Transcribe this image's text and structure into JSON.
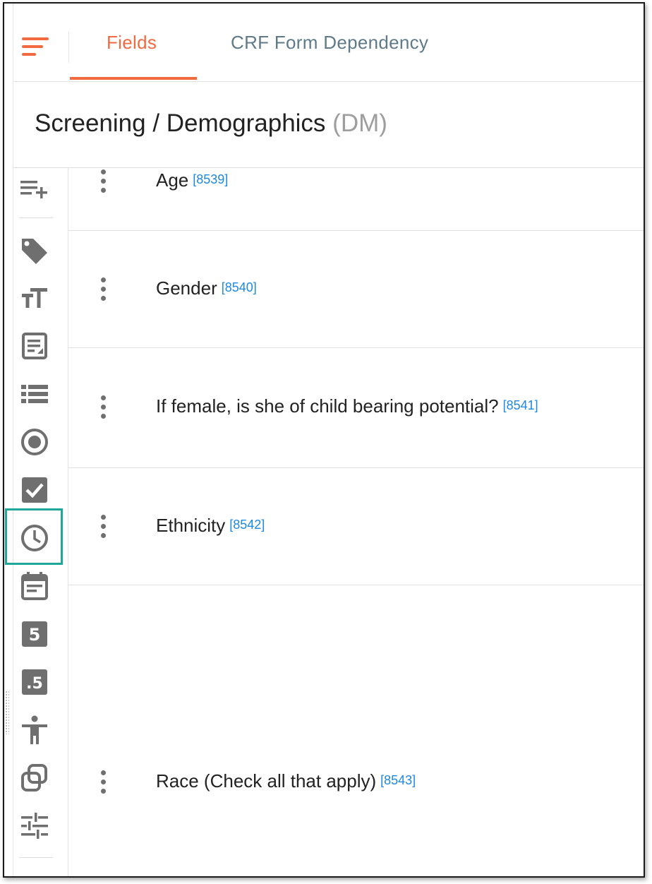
{
  "tabs": [
    {
      "label": "Fields",
      "active": true
    },
    {
      "label": "CRF Form Dependency",
      "active": false
    }
  ],
  "header": {
    "title": "Screening / Demographics",
    "abbr": "(DM)"
  },
  "toolbar": {
    "icons": [
      "add-field-icon",
      "tag-icon",
      "text-size-icon",
      "text-area-icon",
      "list-icon",
      "radio-icon",
      "checkbox-icon",
      "time-icon",
      "date-icon",
      "integer-icon",
      "decimal-icon",
      "person-icon",
      "copy-icon",
      "settings-sliders-icon"
    ],
    "selected": "time-icon"
  },
  "fields": [
    {
      "label": "Age",
      "id": "[8539]"
    },
    {
      "label": "Gender",
      "id": "[8540]"
    },
    {
      "label": "If female, is she of child bearing potential?",
      "id": "[8541]"
    },
    {
      "label": "Ethnicity",
      "id": "[8542]"
    },
    {
      "label": "Race (Check all that apply)",
      "id": "[8543]"
    }
  ],
  "colors": {
    "accent": "#f26a3f",
    "link": "#1e88e5",
    "highlight": "#1fa79a",
    "icon": "#6f6f6f"
  }
}
